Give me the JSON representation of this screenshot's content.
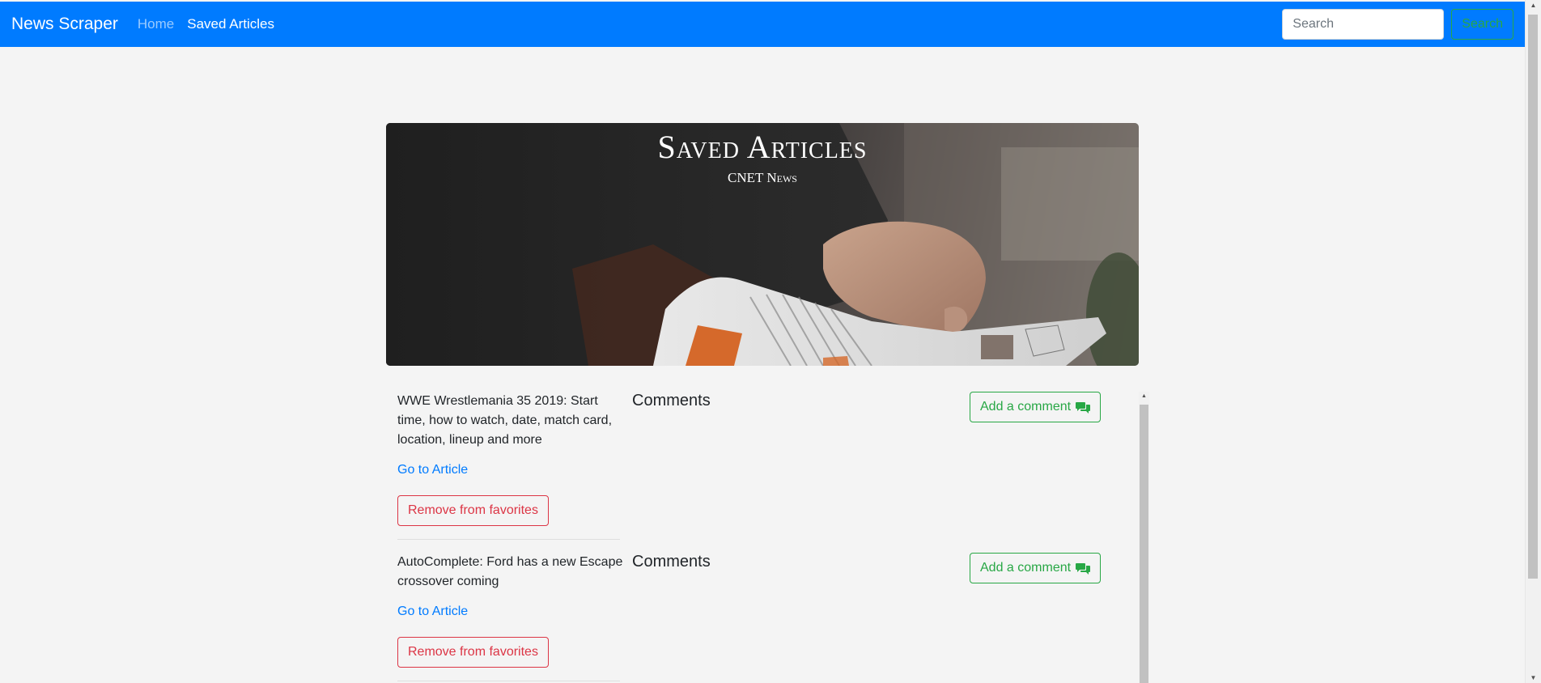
{
  "navbar": {
    "brand": "News Scraper",
    "links": [
      {
        "label": "Home",
        "active": false
      },
      {
        "label": "Saved Articles",
        "active": true
      }
    ],
    "search_placeholder": "Search",
    "search_button": "Search"
  },
  "hero": {
    "title": "Saved Articles",
    "subtitle": "CNET News"
  },
  "articles": [
    {
      "title": "WWE Wrestlemania 35 2019: Start time, how to watch, date, match card, location, lineup and more",
      "link_label": "Go to Article",
      "remove_label": "Remove from favorites",
      "comments_heading": "Comments",
      "add_comment_label": "Add a comment"
    },
    {
      "title": "AutoComplete: Ford has a new Escape crossover coming",
      "link_label": "Go to Article",
      "remove_label": "Remove from favorites",
      "comments_heading": "Comments",
      "add_comment_label": "Add a comment"
    }
  ],
  "icons": {
    "comment_icon": "comments-icon"
  },
  "colors": {
    "navbar": "#007bff",
    "success": "#28a745",
    "danger": "#dc3545",
    "link": "#007bff",
    "background": "#f4f4f4"
  }
}
